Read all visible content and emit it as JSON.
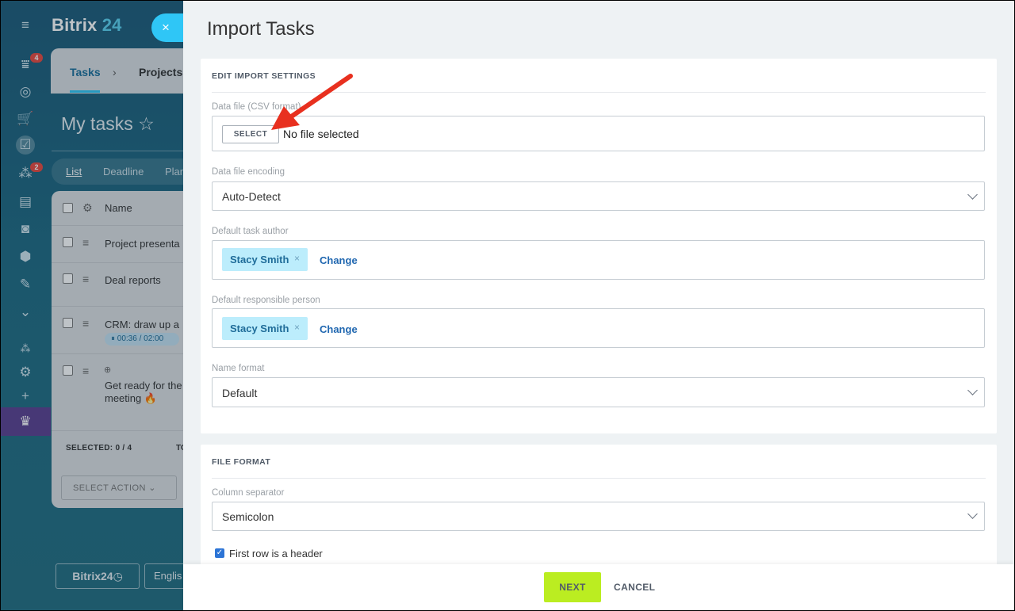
{
  "background_app": {
    "logo_main": "Bitrix",
    "logo_accent": "24",
    "rail_badges": [
      "4",
      "2"
    ],
    "breadcrumb": [
      "Tasks",
      "Projects"
    ],
    "breadcrumb_separator": "›",
    "page_title": "My tasks",
    "view_tabs": [
      "List",
      "Deadline",
      "Plan"
    ],
    "grid_header": "Name",
    "rows": [
      "Project presenta",
      "Deal reports",
      "CRM: draw up a",
      "Get ready for the",
      "meeting"
    ],
    "timer": "00:36 / 02:00",
    "selected_label": "SELECTED: 0 / 4",
    "total_label": "TO",
    "select_action": "SELECT ACTION",
    "footer_logo": "Bitrix24",
    "footer_language": "Englis"
  },
  "panel": {
    "title": "Import Tasks",
    "close_icon": "×",
    "section1": {
      "title": "EDIT IMPORT SETTINGS",
      "data_file_label": "Data file (CSV format)",
      "select_button": "SELECT",
      "no_file": "No file selected",
      "encoding_label": "Data file encoding",
      "encoding_value": "Auto-Detect",
      "author_label": "Default task author",
      "author_name": "Stacy Smith",
      "responsible_label": "Default responsible person",
      "responsible_name": "Stacy Smith",
      "change_label": "Change",
      "tag_remove": "×",
      "name_format_label": "Name format",
      "name_format_value": "Default"
    },
    "section2": {
      "title": "FILE FORMAT",
      "separator_label": "Column separator",
      "separator_value": "Semicolon",
      "header_checkbox_label": "First row is a header",
      "header_checked": true
    },
    "footer": {
      "next": "NEXT",
      "cancel": "CANCEL"
    }
  },
  "colors": {
    "accent_green": "#bbed21",
    "tag_bg": "#bcedfc",
    "link_blue": "#2067b0",
    "annotation_arrow": "#e8301f"
  }
}
